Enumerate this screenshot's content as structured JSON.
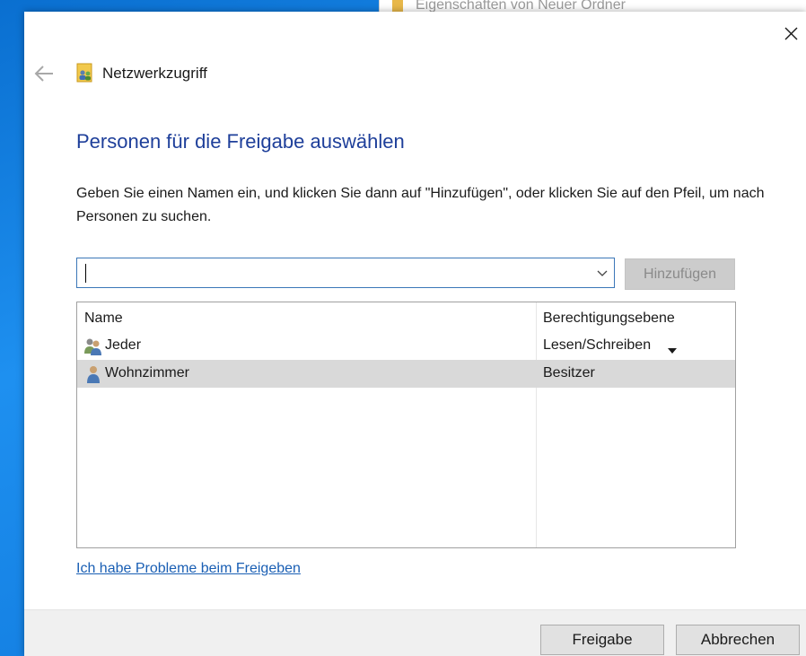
{
  "background_window": {
    "title": "Eigenschaften von Neuer Ordner"
  },
  "dialog": {
    "window_title": "Netzwerkzugriff",
    "heading": "Personen für die Freigabe auswählen",
    "instruction": "Geben Sie einen Namen ein, und klicken Sie dann auf \"Hinzufügen\", oder klicken Sie auf den Pfeil, um nach Personen zu suchen.",
    "name_input": {
      "value": "",
      "placeholder": ""
    },
    "add_button": "Hinzufügen",
    "columns": {
      "name": "Name",
      "permission": "Berechtigungsebene"
    },
    "rows": [
      {
        "name": "Jeder",
        "permission": "Lesen/Schreiben",
        "icon": "group-users-icon",
        "selected": false
      },
      {
        "name": "Wohnzimmer",
        "permission": "Besitzer",
        "icon": "user-icon",
        "selected": true
      }
    ],
    "help_link": "Ich habe Probleme beim Freigeben",
    "share_button": "Freigabe",
    "cancel_button": "Abbrechen"
  },
  "colors": {
    "heading": "#1e3f9a",
    "link": "#1a5fb4",
    "input_border": "#3b77b8",
    "selected_row": "#d9d9d9",
    "desktop": "#1a86e0"
  }
}
